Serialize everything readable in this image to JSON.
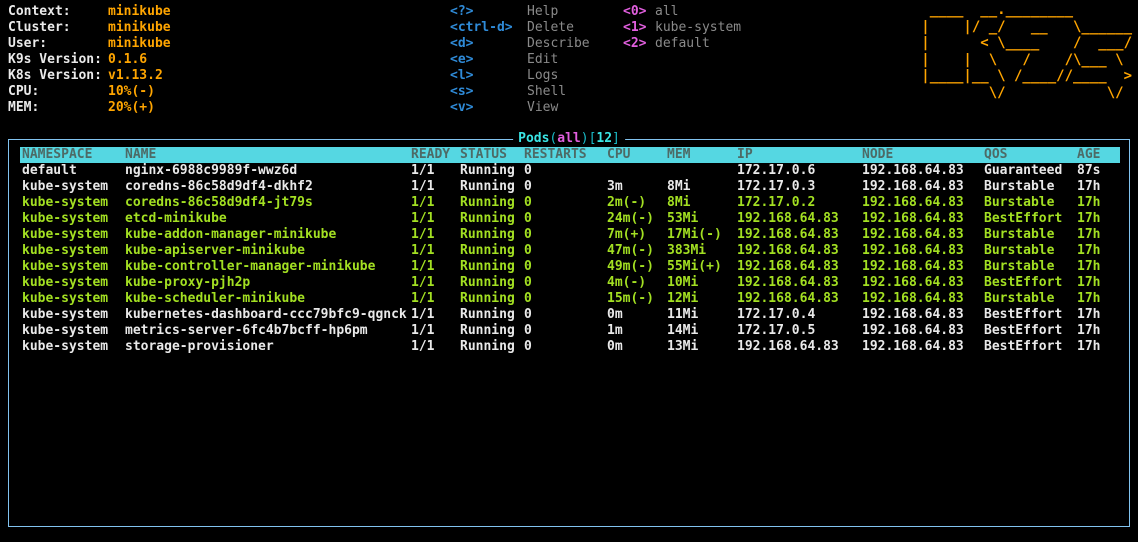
{
  "colors": {
    "background": "#000000",
    "accent_orange": "#ffa500",
    "key_blue": "#2f8bd8",
    "key_magenta": "#e25fdf",
    "title_cyan": "#3ae6e6",
    "header_band_cyan": "#55d7e2",
    "row_green": "#a3e022",
    "row_white": "#e9e9e9",
    "border_blue": "#82c3ef"
  },
  "cluster_info": {
    "rows": [
      {
        "label": "Context:",
        "value": "minikube"
      },
      {
        "label": "Cluster:",
        "value": "minikube"
      },
      {
        "label": "User:",
        "value": "minikube"
      },
      {
        "label": "K9s Version:",
        "value": "0.1.6"
      },
      {
        "label": "K8s Version:",
        "value": "v1.13.2"
      },
      {
        "label": "CPU:",
        "value": "10%(-)"
      },
      {
        "label": "MEM:",
        "value": "20%(+)"
      }
    ]
  },
  "menu": {
    "actions": [
      {
        "key": "<?>",
        "label": "Help"
      },
      {
        "key": "<ctrl-d>",
        "label": "Delete"
      },
      {
        "key": "<d>",
        "label": "Describe"
      },
      {
        "key": "<e>",
        "label": "Edit"
      },
      {
        "key": "<l>",
        "label": "Logs"
      },
      {
        "key": "<s>",
        "label": "Shell"
      },
      {
        "key": "<v>",
        "label": "View"
      }
    ],
    "namespaces": [
      {
        "key": "<0>",
        "label": "all"
      },
      {
        "key": "<1>",
        "label": "kube-system"
      },
      {
        "key": "<2>",
        "label": "default"
      }
    ]
  },
  "logo_ascii": " ____  __.________\n|    |/ _/   __   \\______\n|      < \\____    /  ___/\n|    |  \\   /    /\\___ \\\n|____|__ \\ /____//____  >\n        \\/            \\/",
  "pods_panel": {
    "title": {
      "resource": "Pods",
      "open_paren": "(",
      "namespace": "all",
      "close_open_bracket": ")[",
      "count": "12",
      "close_bracket": "]"
    },
    "columns": [
      "NAMESPACE",
      "NAME",
      "READY",
      "STATUS",
      "RESTARTS",
      "CPU",
      "MEM",
      "IP",
      "NODE",
      "QOS",
      "AGE"
    ],
    "rows": [
      {
        "namespace": "default",
        "name": "nginx-6988c9989f-wwz6d",
        "ready": "1/1",
        "status": "Running",
        "restarts": "0",
        "cpu": "",
        "mem": "",
        "ip": "172.17.0.6",
        "node": "192.168.64.83",
        "qos": "Guaranteed",
        "age": "87s",
        "highlight": "white"
      },
      {
        "namespace": "kube-system",
        "name": "coredns-86c58d9df4-dkhf2",
        "ready": "1/1",
        "status": "Running",
        "restarts": "0",
        "cpu": "3m",
        "mem": "8Mi",
        "ip": "172.17.0.3",
        "node": "192.168.64.83",
        "qos": "Burstable",
        "age": "17h",
        "highlight": "white"
      },
      {
        "namespace": "kube-system",
        "name": "coredns-86c58d9df4-jt79s",
        "ready": "1/1",
        "status": "Running",
        "restarts": "0",
        "cpu": "2m(-)",
        "mem": "8Mi",
        "ip": "172.17.0.2",
        "node": "192.168.64.83",
        "qos": "Burstable",
        "age": "17h",
        "highlight": "green"
      },
      {
        "namespace": "kube-system",
        "name": "etcd-minikube",
        "ready": "1/1",
        "status": "Running",
        "restarts": "0",
        "cpu": "24m(-)",
        "mem": "53Mi",
        "ip": "192.168.64.83",
        "node": "192.168.64.83",
        "qos": "BestEffort",
        "age": "17h",
        "highlight": "green"
      },
      {
        "namespace": "kube-system",
        "name": "kube-addon-manager-minikube",
        "ready": "1/1",
        "status": "Running",
        "restarts": "0",
        "cpu": "7m(+)",
        "mem": "17Mi(-)",
        "ip": "192.168.64.83",
        "node": "192.168.64.83",
        "qos": "Burstable",
        "age": "17h",
        "highlight": "green"
      },
      {
        "namespace": "kube-system",
        "name": "kube-apiserver-minikube",
        "ready": "1/1",
        "status": "Running",
        "restarts": "0",
        "cpu": "47m(-)",
        "mem": "383Mi",
        "ip": "192.168.64.83",
        "node": "192.168.64.83",
        "qos": "Burstable",
        "age": "17h",
        "highlight": "green"
      },
      {
        "namespace": "kube-system",
        "name": "kube-controller-manager-minikube",
        "ready": "1/1",
        "status": "Running",
        "restarts": "0",
        "cpu": "49m(-)",
        "mem": "55Mi(+)",
        "ip": "192.168.64.83",
        "node": "192.168.64.83",
        "qos": "Burstable",
        "age": "17h",
        "highlight": "green"
      },
      {
        "namespace": "kube-system",
        "name": "kube-proxy-pjh2p",
        "ready": "1/1",
        "status": "Running",
        "restarts": "0",
        "cpu": "4m(-)",
        "mem": "10Mi",
        "ip": "192.168.64.83",
        "node": "192.168.64.83",
        "qos": "BestEffort",
        "age": "17h",
        "highlight": "green"
      },
      {
        "namespace": "kube-system",
        "name": "kube-scheduler-minikube",
        "ready": "1/1",
        "status": "Running",
        "restarts": "0",
        "cpu": "15m(-)",
        "mem": "12Mi",
        "ip": "192.168.64.83",
        "node": "192.168.64.83",
        "qos": "Burstable",
        "age": "17h",
        "highlight": "green"
      },
      {
        "namespace": "kube-system",
        "name": "kubernetes-dashboard-ccc79bfc9-qgnck",
        "ready": "1/1",
        "status": "Running",
        "restarts": "0",
        "cpu": "0m",
        "mem": "11Mi",
        "ip": "172.17.0.4",
        "node": "192.168.64.83",
        "qos": "BestEffort",
        "age": "17h",
        "highlight": "white"
      },
      {
        "namespace": "kube-system",
        "name": "metrics-server-6fc4b7bcff-hp6pm",
        "ready": "1/1",
        "status": "Running",
        "restarts": "0",
        "cpu": "1m",
        "mem": "14Mi",
        "ip": "172.17.0.5",
        "node": "192.168.64.83",
        "qos": "BestEffort",
        "age": "17h",
        "highlight": "white"
      },
      {
        "namespace": "kube-system",
        "name": "storage-provisioner",
        "ready": "1/1",
        "status": "Running",
        "restarts": "0",
        "cpu": "0m",
        "mem": "13Mi",
        "ip": "192.168.64.83",
        "node": "192.168.64.83",
        "qos": "BestEffort",
        "age": "17h",
        "highlight": "white"
      }
    ]
  }
}
